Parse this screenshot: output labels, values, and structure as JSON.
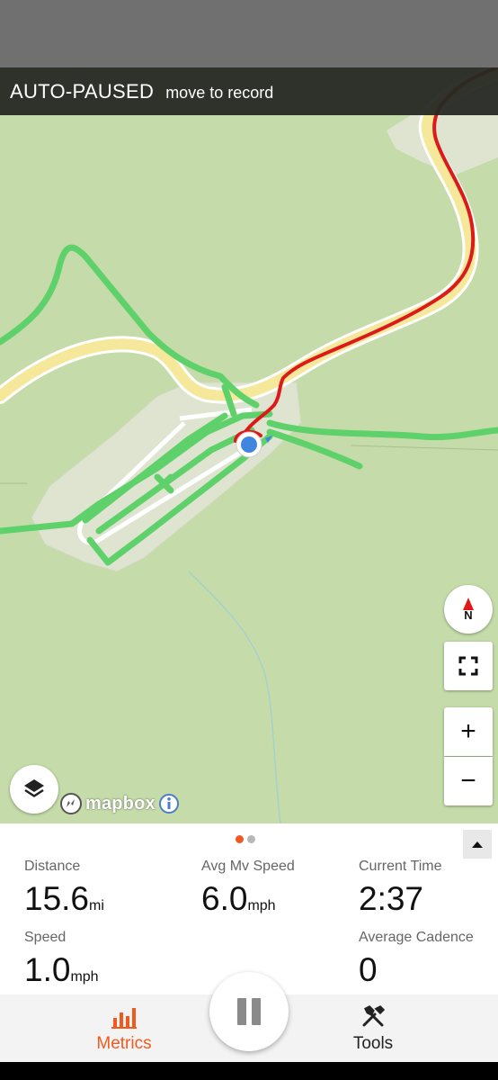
{
  "banner": {
    "status": "AUTO-PAUSED",
    "hint": "move to record"
  },
  "map": {
    "compass_letter": "N",
    "zoom_in": "+",
    "zoom_out": "−",
    "attribution": "mapbox",
    "colors": {
      "land": "#c5dcaa",
      "road": "#f5e89a",
      "trail": "#5fd16b",
      "route": "#dd1a1a",
      "location": "#3f86e0"
    }
  },
  "pager": {
    "active_color": "#f05a1e",
    "inactive_color": "#b8b8b8"
  },
  "metrics": {
    "distance": {
      "label": "Distance",
      "value": "15.6",
      "unit": "mi"
    },
    "avg_mv_speed": {
      "label": "Avg Mv Speed",
      "value": "6.0",
      "unit": "mph"
    },
    "current_time": {
      "label": "Current Time",
      "value": "2:37"
    },
    "speed": {
      "label": "Speed",
      "value": "1.0",
      "unit": "mph"
    },
    "average_cadence": {
      "label": "Average Cadence",
      "value": "0"
    }
  },
  "nav": {
    "metrics": {
      "label": "Metrics",
      "icon": "bar-chart-icon",
      "color": "#f05a1e"
    },
    "tools": {
      "label": "Tools",
      "icon": "tools-icon",
      "color": "#222222"
    },
    "pause_icon": "pause-icon"
  }
}
